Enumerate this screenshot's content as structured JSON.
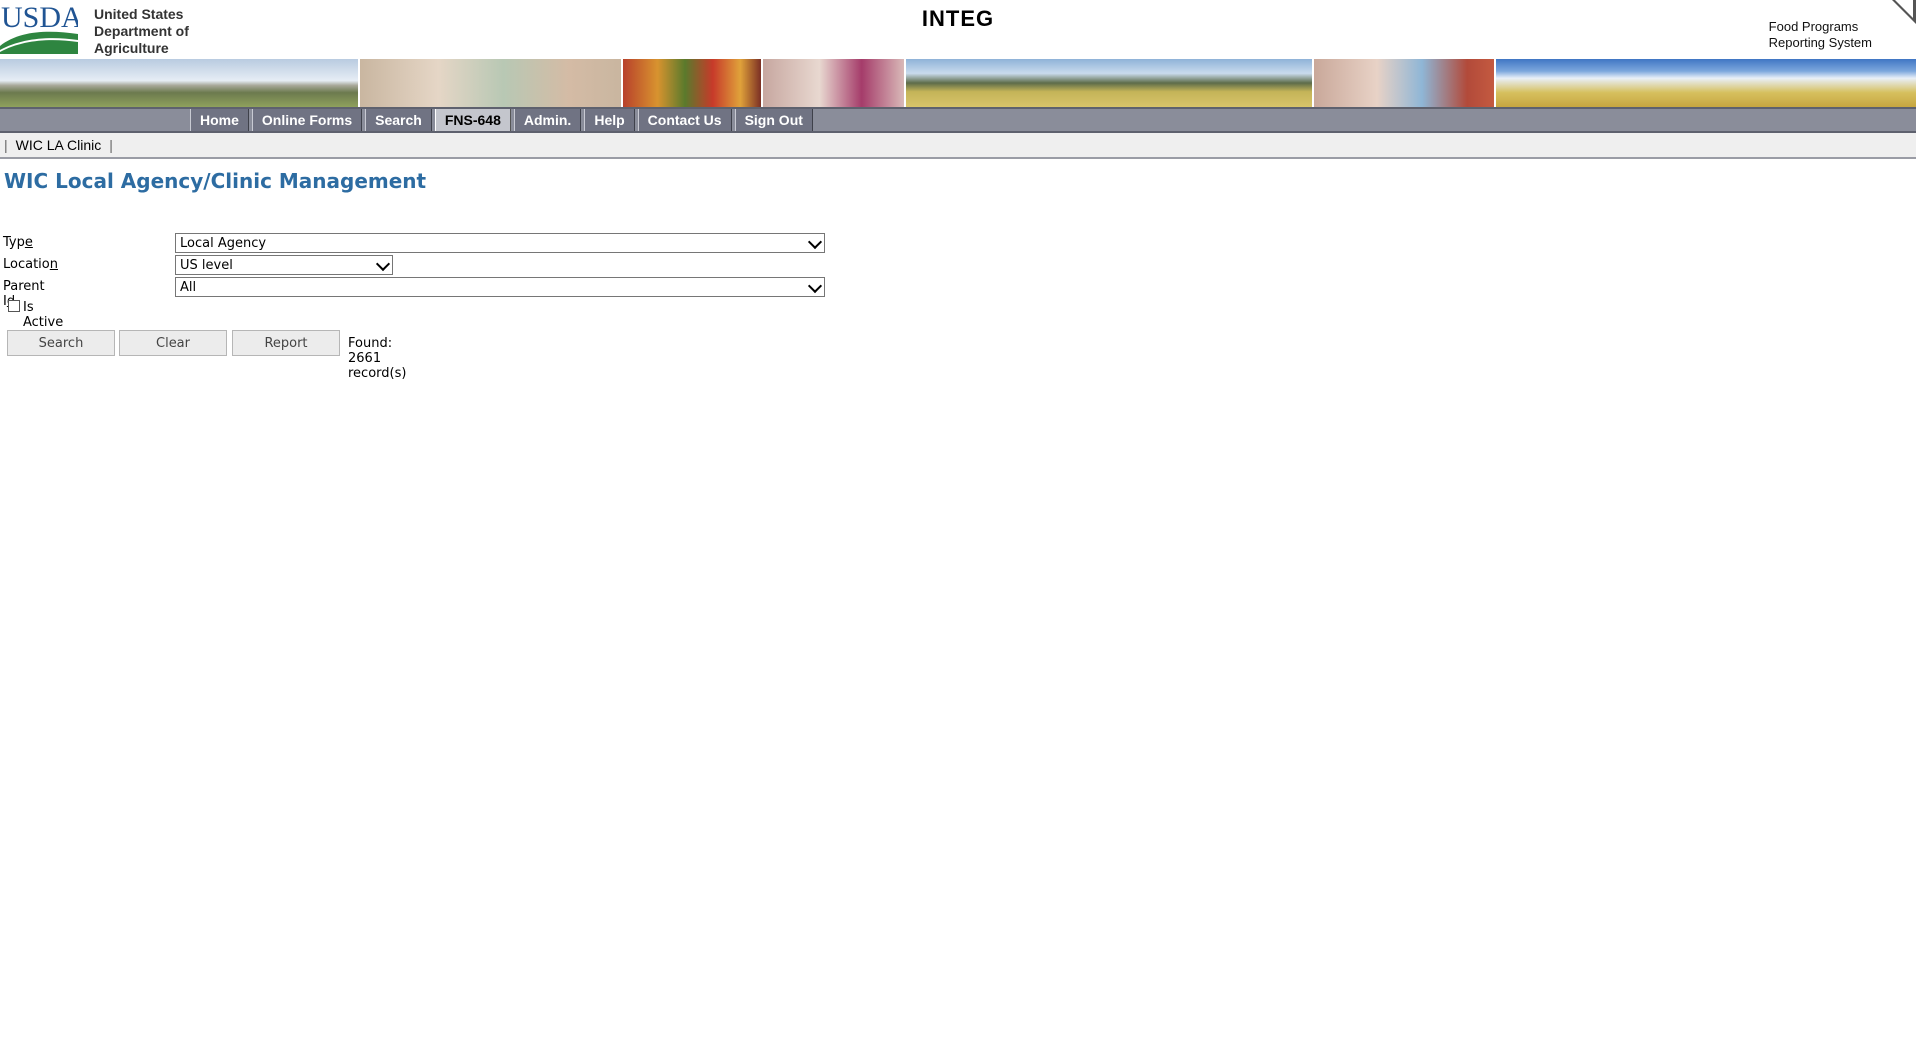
{
  "header": {
    "logo_text": "USDA",
    "agency_lines": [
      "United States",
      "Department of",
      "Agriculture"
    ],
    "app_title": "INTEG",
    "system_lines": [
      "Food Programs",
      "Reporting System"
    ]
  },
  "nav": {
    "items": [
      {
        "label": "Home",
        "active": false
      },
      {
        "label": "Online Forms",
        "active": false
      },
      {
        "label": "Search",
        "active": false
      },
      {
        "label": "FNS-648",
        "active": true
      },
      {
        "label": "Admin.",
        "active": false
      },
      {
        "label": "Help",
        "active": false
      },
      {
        "label": "Contact Us",
        "active": false
      },
      {
        "label": "Sign Out",
        "active": false
      }
    ]
  },
  "breadcrumb": {
    "link": "WIC LA Clinic",
    "separator": "|"
  },
  "page": {
    "title": "WIC Local Agency/Clinic Management"
  },
  "form": {
    "type": {
      "label_pre": "Typ",
      "label_key": "e",
      "label_post": "",
      "value": "Local Agency"
    },
    "location": {
      "label_pre": "Locatio",
      "label_key": "n",
      "label_post": "",
      "value": "US level"
    },
    "parent_id": {
      "label_pre": "Parent I",
      "label_key": "d",
      "label_post": "",
      "value": "All"
    },
    "is_active": {
      "label": "Is Active",
      "checked": false
    }
  },
  "actions": {
    "search_label": "Search",
    "clear_label": "Clear",
    "report_label": "Report",
    "found_text": "Found: 2661 record(s)"
  },
  "colors": {
    "title": "#2d6ca2",
    "nav_bg": "#8a8d9a",
    "nav_active": "#c4c6cd",
    "usda_blue": "#205493",
    "usda_green": "#2e8540"
  }
}
